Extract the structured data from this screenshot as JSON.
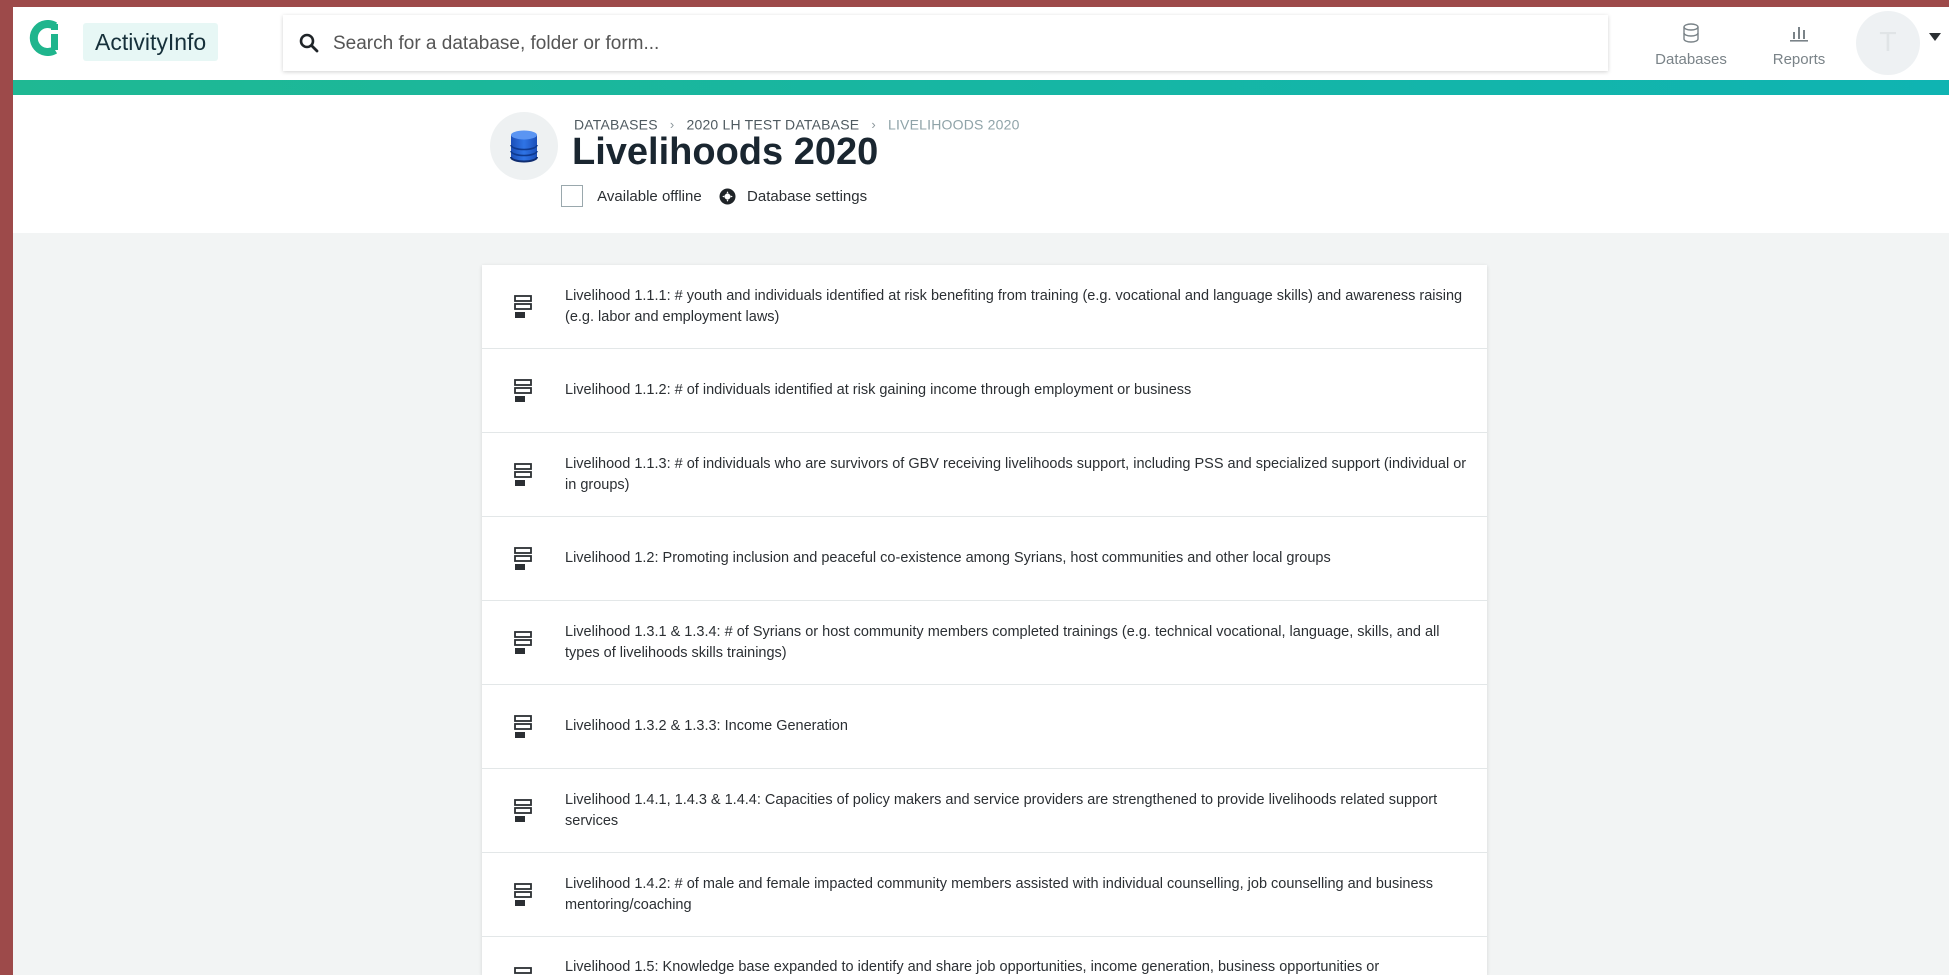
{
  "app": {
    "brand": "ActivityInfo",
    "search_placeholder": "Search for a database, folder or form...",
    "nav": [
      {
        "label": "Databases",
        "icon": "database-icon"
      },
      {
        "label": "Reports",
        "icon": "bar-chart-icon"
      }
    ],
    "avatar_initial": "T",
    "accent_color": "#1fb893"
  },
  "breadcrumb": {
    "items": [
      "DATABASES",
      "2020 LH TEST DATABASE"
    ],
    "current": "LIVELIHOODS 2020"
  },
  "page": {
    "title": "Livelihoods 2020",
    "offline_label": "Available offline",
    "settings_label": "Database settings"
  },
  "forms": [
    {
      "label": "Livelihood 1.1.1: # youth and individuals identified at risk benefiting from training (e.g. vocational and language skills) and awareness raising (e.g. labor and employment laws)"
    },
    {
      "label": "Livelihood 1.1.2: # of individuals identified at risk gaining income through employment or business"
    },
    {
      "label": "Livelihood 1.1.3: # of individuals who are survivors of GBV receiving livelihoods support, including PSS and specialized support (individual or in groups)"
    },
    {
      "label": "Livelihood 1.2: Promoting inclusion and peaceful co-existence among Syrians, host communities and other local groups"
    },
    {
      "label": "Livelihood 1.3.1 & 1.3.4: # of Syrians or host community members completed trainings (e.g. technical vocational, language, skills, and all types of livelihoods skills trainings)"
    },
    {
      "label": "Livelihood 1.3.2 & 1.3.3: Income Generation"
    },
    {
      "label": "Livelihood 1.4.1, 1.4.3 & 1.4.4: Capacities of policy makers and service providers are strengthened to provide livelihoods related support services"
    },
    {
      "label": "Livelihood 1.4.2: # of male and female impacted community members assisted with individual counselling, job counselling and business mentoring/coaching"
    },
    {
      "label": "Livelihood 1.5: Knowledge base expanded to identify and share job opportunities, income generation, business opportunities or"
    }
  ]
}
